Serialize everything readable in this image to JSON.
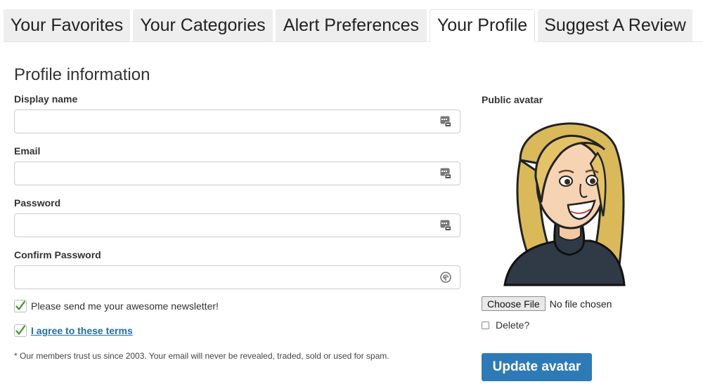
{
  "tabs": [
    {
      "label": "Your Favorites",
      "active": false
    },
    {
      "label": "Your Categories",
      "active": false
    },
    {
      "label": "Alert Preferences",
      "active": false
    },
    {
      "label": "Your Profile",
      "active": true
    },
    {
      "label": "Suggest A Review",
      "active": false
    }
  ],
  "form": {
    "title": "Profile information",
    "fields": [
      {
        "label": "Display name",
        "value": ""
      },
      {
        "label": "Email",
        "value": ""
      },
      {
        "label": "Password",
        "value": ""
      },
      {
        "label": "Confirm Password",
        "value": ""
      }
    ],
    "newsletter": {
      "label": "Please send me your awesome newsletter!",
      "checked": true
    },
    "terms": {
      "label": "I agree to these terms",
      "checked": true
    },
    "footnote": "* Our members trust us since 2003. Your email will never be revealed, traded, sold or used for spam."
  },
  "avatar": {
    "label": "Public avatar",
    "choose_file": "Choose File",
    "file_status": "No file chosen",
    "delete_label": "Delete?",
    "update_button": "Update avatar"
  },
  "colors": {
    "accent": "#2e7ab6",
    "link": "#1f6fa8",
    "check": "#3a9a2e",
    "tab_bg": "#eeeeee"
  },
  "icons": {
    "field_icon": "password-manager-icon",
    "confirm_icon": "fingerprint-icon",
    "check_icon": "checkmark-icon"
  }
}
